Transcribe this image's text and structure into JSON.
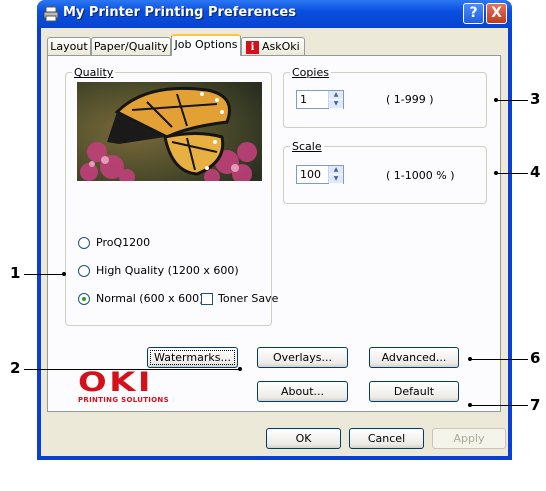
{
  "window": {
    "title": "My Printer Printing Preferences",
    "help_button": "?",
    "close_button": "X"
  },
  "tabs": [
    {
      "label": "Layout"
    },
    {
      "label": "Paper/Quality"
    },
    {
      "label": "Job Options",
      "active": true
    },
    {
      "label": "AskOki"
    }
  ],
  "quality": {
    "group_label": "Quality",
    "options": [
      {
        "label": "ProQ1200",
        "checked": false
      },
      {
        "label": "High Quality (1200 x 600)",
        "checked": false
      },
      {
        "label": "Normal (600 x 600)",
        "checked": true
      }
    ],
    "toner_save_label": "Toner Save",
    "toner_save_checked": false
  },
  "copies": {
    "group_label": "Copies",
    "value": "1",
    "range": "( 1-999 )"
  },
  "scale": {
    "group_label": "Scale",
    "value": "100",
    "range": "( 1-1000 % )"
  },
  "buttons": {
    "watermarks": "Watermarks...",
    "overlays": "Overlays...",
    "advanced": "Advanced...",
    "about": "About...",
    "default": "Default"
  },
  "brand": {
    "logo_text": "OKI",
    "tagline": "PRINTING SOLUTIONS",
    "color": "#d6101a"
  },
  "footer": {
    "ok": "OK",
    "cancel": "Cancel",
    "apply": "Apply"
  },
  "callouts": [
    "1",
    "2",
    "3",
    "4",
    "6",
    "7"
  ],
  "colors": {
    "titlebar": "#0a4fe0",
    "dialog_bg": "#ece9d8",
    "active_tab_accent": "#ffc83c"
  }
}
